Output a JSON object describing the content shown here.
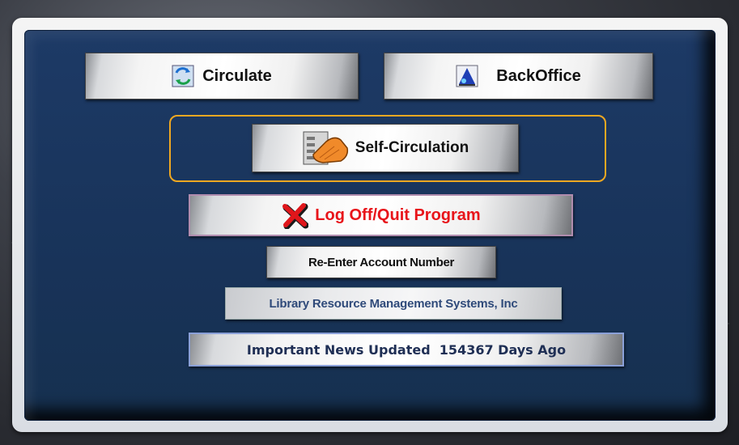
{
  "header": {
    "partial_text": ""
  },
  "buttons": {
    "circulate": {
      "label": "Circulate",
      "icon": "circulate-icon"
    },
    "backoffice": {
      "label": "BackOffice",
      "icon": "backoffice-icon"
    },
    "self_circulation": {
      "label": "Self-Circulation",
      "icon": "hand-pointer-icon"
    },
    "logoff": {
      "label": "Log Off/Quit Program",
      "icon": "red-x-icon"
    },
    "reenter": {
      "label": "Re-Enter Account Number"
    },
    "lrms": {
      "label": "Library Resource Management Systems, Inc"
    },
    "news": {
      "label": "Important News Updated  154367 Days Ago"
    }
  },
  "colors": {
    "panel": "#1b3862",
    "highlight_outline": "#f0a821",
    "logoff_text": "#e8141a",
    "header_text": "#ff1a1a"
  }
}
